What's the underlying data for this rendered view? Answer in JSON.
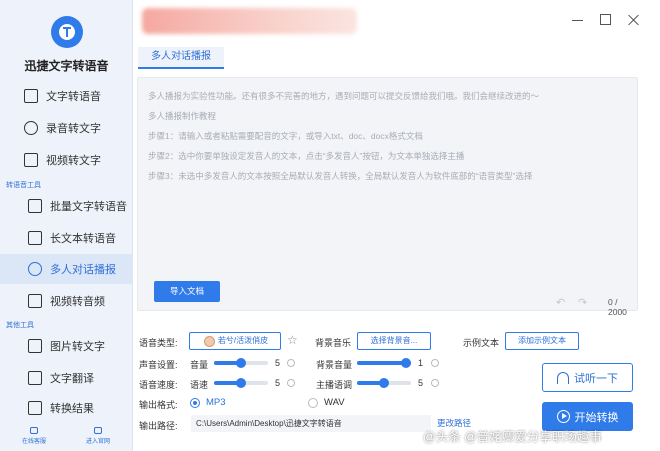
{
  "app": {
    "title": "迅捷文字转语音"
  },
  "sidebar": {
    "items": [
      {
        "label": "文字转语音",
        "icon": "text-to-speech-icon"
      },
      {
        "label": "录音转文字",
        "icon": "mic-icon"
      },
      {
        "label": "视频转文字",
        "icon": "video-icon"
      }
    ],
    "group1": "转语音工具",
    "group1_items": [
      {
        "label": "批量文字转语音",
        "icon": "batch-icon"
      },
      {
        "label": "长文本转语音",
        "icon": "long-text-icon"
      },
      {
        "label": "多人对话播报",
        "icon": "users-icon",
        "active": true
      },
      {
        "label": "视频转音频",
        "icon": "video-audio-icon"
      }
    ],
    "group2": "其他工具",
    "group2_items": [
      {
        "label": "图片转文字",
        "icon": "image-icon"
      },
      {
        "label": "文字翻译",
        "icon": "translate-icon"
      },
      {
        "label": "转换结果",
        "icon": "result-icon"
      }
    ],
    "bottom": [
      "在线客服",
      "进入官网"
    ]
  },
  "tab": {
    "label": "多人对话播报"
  },
  "editor": {
    "lines": [
      "多人播报为实验性功能。还有很多不完善的地方，遇到问题可以提交反馈给我们哦。我们会继续改进的～",
      "多人播报制作教程",
      "步骤1：请输入或者粘贴需要配音的文字，或导入txt、doc、docx格式文档",
      "步骤2：选中你要单独设定发音人的文本，点击“多发音人”按钮，为文本单独选择主播",
      "步骤3：未选中多发音人的文本按照全局默认发音人转换，全局默认发音人为软件底部的“语音类型”选择"
    ],
    "import_label": "导入文档",
    "counter": "0 / 2000"
  },
  "settings": {
    "voice_type_label": "语音类型:",
    "voice_name": "若兮/活泼俏皮",
    "bg_music_label": "背景音乐",
    "bg_music_btn": "选择背景音...",
    "example_label": "示例文本",
    "example_btn": "添加示例文本",
    "sound_label": "声音设置:",
    "volume_label": "音量",
    "volume_value": "5",
    "volume_level": 0.5,
    "bg_volume_label": "背景音量",
    "bg_volume_value": "1",
    "bg_volume_level": 1.0,
    "speed_label": "语音速度:",
    "speed_sub": "语速",
    "speed_value": "5",
    "speed_level": 0.5,
    "pitch_label": "主播语调",
    "pitch_value": "5",
    "pitch_level": 0.5,
    "format_label": "输出格式:",
    "format_mp3": "MP3",
    "format_wav": "WAV",
    "path_label": "输出路径:",
    "path_value": "C:\\Users\\Admin\\Desktop\\迅捷文字转语音",
    "change_path": "更改路径",
    "listen_btn": "试听一下",
    "convert_btn": "开始转换"
  },
  "watermark": "@头条 @普姥卿爱分享职场趣事",
  "colors": {
    "accent": "#2f7bea",
    "sidebar_bg": "#eef3fb"
  }
}
